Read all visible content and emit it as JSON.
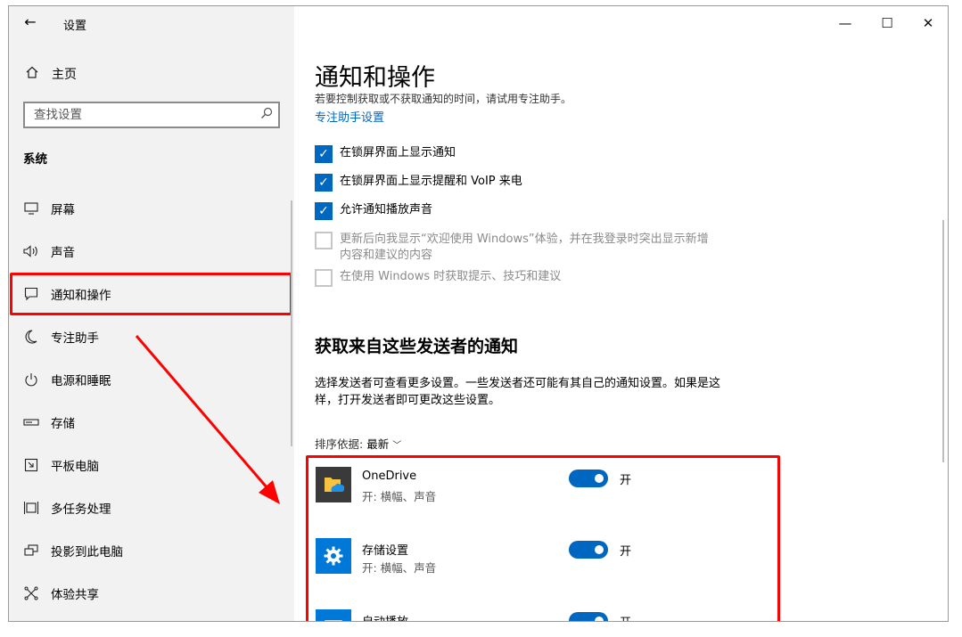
{
  "window": {
    "title": "设置",
    "controls": {
      "minimize": "—",
      "maximize": "☐",
      "close": "✕"
    }
  },
  "sidebar": {
    "back_icon": "←",
    "home_label": "主页",
    "search_placeholder": "查找设置",
    "section": "系统",
    "items": [
      {
        "label": "屏幕",
        "icon": "monitor-icon"
      },
      {
        "label": "声音",
        "icon": "speaker-icon"
      },
      {
        "label": "通知和操作",
        "icon": "notification-icon",
        "active": true
      },
      {
        "label": "专注助手",
        "icon": "moon-icon"
      },
      {
        "label": "电源和睡眠",
        "icon": "power-icon"
      },
      {
        "label": "存储",
        "icon": "storage-icon"
      },
      {
        "label": "平板电脑",
        "icon": "tablet-icon"
      },
      {
        "label": "多任务处理",
        "icon": "multitask-icon"
      },
      {
        "label": "投影到此电脑",
        "icon": "project-icon"
      },
      {
        "label": "体验共享",
        "icon": "share-icon"
      }
    ]
  },
  "main": {
    "title": "通知和操作",
    "subtitle": "若要控制获取或不获取通知的时间，请试用专注助手。",
    "focus_link": "专注助手设置",
    "checkboxes": [
      {
        "label": "在锁屏界面上显示通知",
        "checked": true
      },
      {
        "label": "在锁屏界面上显示提醒和 VoIP 来电",
        "checked": true
      },
      {
        "label": "允许通知播放声音",
        "checked": true
      },
      {
        "label": "更新后向我显示“欢迎使用 Windows”体验，并在我登录时突出显示新增内容和建议的内容",
        "checked": false
      },
      {
        "label": "在使用 Windows 时获取提示、技巧和建议",
        "checked": false
      }
    ],
    "senders_title": "获取来自这些发送者的通知",
    "senders_desc": "选择发送者可查看更多设置。一些发送者还可能有其自己的通知设置。如果是这样，打开发送者即可更改这些设置。",
    "sort_label": "排序依据:",
    "sort_value": "最新",
    "apps": [
      {
        "name": "OneDrive",
        "sub": "开: 横幅、声音",
        "toggle": "开",
        "icon": "onedrive-icon",
        "color": "#3a3a3a"
      },
      {
        "name": "存储设置",
        "sub": "开: 横幅、声音",
        "toggle": "开",
        "icon": "gear-icon",
        "color": "#0078d7"
      },
      {
        "name": "自动播放",
        "sub": "",
        "toggle": "开",
        "icon": "autoplay-icon",
        "color": "#0078d7"
      }
    ]
  },
  "colors": {
    "accent": "#0067c0",
    "highlight": "#ff0000",
    "sidebar_bg": "#f2f2f2"
  }
}
